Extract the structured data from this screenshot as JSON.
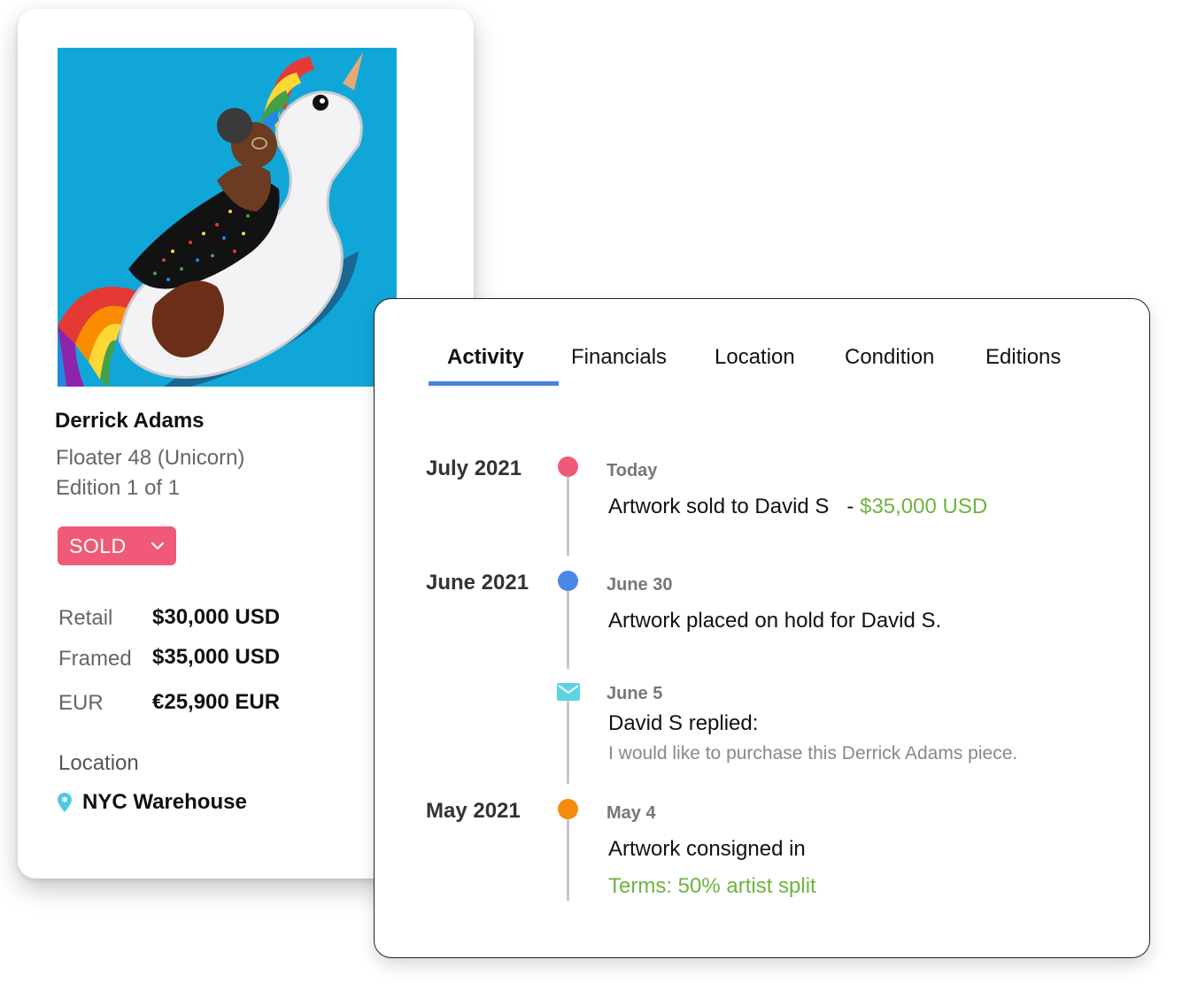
{
  "artwork_card": {
    "artist": "Derrick Adams",
    "title": "Floater 48 (Unicorn)",
    "edition": "Edition  1  of  1",
    "status": "SOLD",
    "prices": [
      {
        "label": "Retail",
        "value": "$30,000 USD"
      },
      {
        "label": "Framed",
        "value": "$35,000 USD"
      },
      {
        "label": "EUR",
        "value": "€25,900 EUR"
      }
    ],
    "location_label": "Location",
    "location_value": "NYC Warehouse",
    "status_color": "#f05a78"
  },
  "tabs": [
    "Activity",
    "Financials",
    "Location",
    "Condition",
    "Editions"
  ],
  "active_tab": "Activity",
  "timeline": {
    "months": [
      "July 2021",
      "June 2021",
      "May 2021"
    ],
    "events": [
      {
        "date": "Today",
        "text": "Artwork sold to David S",
        "amount": "$35,000 USD",
        "dot_color": "#f05a78"
      },
      {
        "date": "June 30",
        "text": "Artwork placed on hold for David S.",
        "dot_color": "#4a86e8"
      },
      {
        "date": "June 5",
        "text": "David S replied:",
        "message": "I would like to purchase this Derrick Adams piece.",
        "icon": "mail-icon",
        "icon_color": "#5dd4e6"
      },
      {
        "date": "May 4",
        "text": "Artwork consigned in",
        "terms": "Terms: 50% artist split",
        "dot_color": "#f58a0c"
      }
    ]
  },
  "accent_green": "#6fb33f",
  "accent_blue": "#4a7fe0"
}
